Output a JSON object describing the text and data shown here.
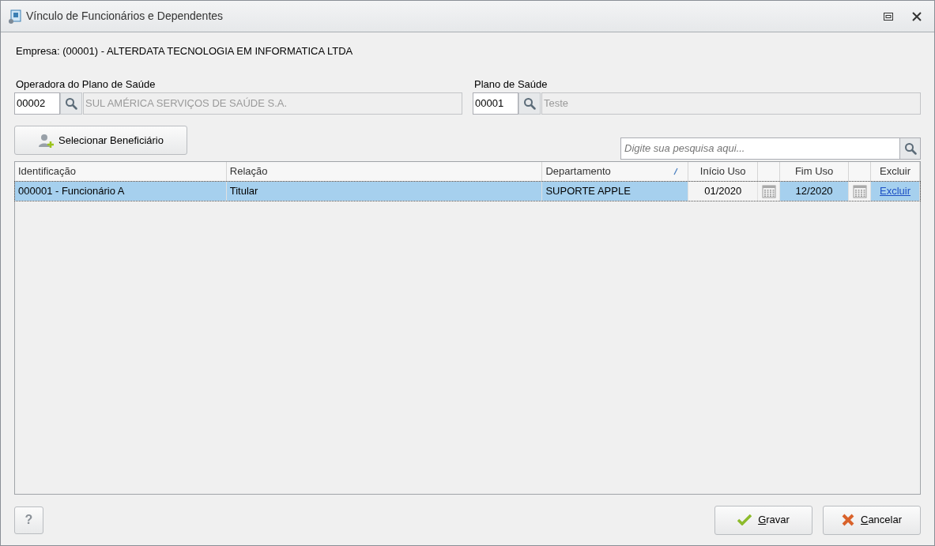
{
  "window": {
    "title": "Vínculo de Funcionários e Dependentes"
  },
  "empresa": "Empresa: (00001) - ALTERDATA TECNOLOGIA EM INFORMATICA LTDA",
  "lookups": [
    {
      "label": "Operadora do Plano de Saúde",
      "code": "00002",
      "description": "SUL AMÉRICA SERVIÇOS DE SAÚDE S.A."
    },
    {
      "label": "Plano de Saúde",
      "code": "00001",
      "description": "Teste"
    }
  ],
  "select_button": "Selecionar Beneficiário",
  "search": {
    "placeholder": "Digite sua pesquisa aqui..."
  },
  "table": {
    "columns": [
      {
        "label": "Identificação",
        "kind": "text",
        "sorted": false
      },
      {
        "label": "Relação",
        "kind": "text",
        "sorted": false
      },
      {
        "label": "Departamento",
        "kind": "text",
        "sorted": true
      },
      {
        "label": "Início Uso",
        "kind": "date",
        "sorted": false
      },
      {
        "kind": "calendar"
      },
      {
        "label": "Fim Uso",
        "kind": "date",
        "sorted": false
      },
      {
        "kind": "calendar"
      },
      {
        "label": "Excluir",
        "kind": "link",
        "sorted": false
      }
    ],
    "rows": [
      {
        "selected": true,
        "cells": [
          {
            "text": "000001 - Funcionário A",
            "focused": false
          },
          {
            "text": "Titular",
            "focused": false
          },
          {
            "text": "SUPORTE APPLE",
            "focused": false
          },
          {
            "text": "01/2020",
            "focused": true
          },
          {
            "focused": false
          },
          {
            "text": "12/2020",
            "focused": false
          },
          {
            "focused": false
          },
          {
            "text": "Excluir",
            "focused": false
          }
        ]
      }
    ]
  },
  "help_button": "?",
  "buttons": [
    {
      "label": "Gravar",
      "kind": "save",
      "underline_first": true
    },
    {
      "label": "Cancelar",
      "kind": "cancel",
      "underline_first": true
    }
  ]
}
